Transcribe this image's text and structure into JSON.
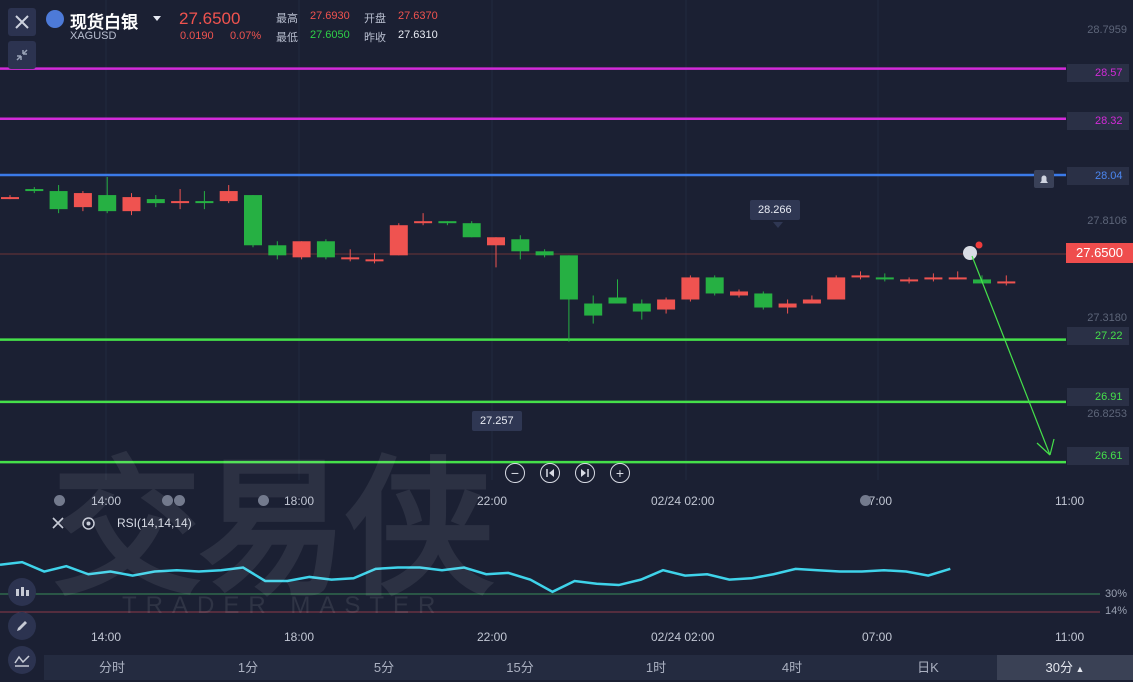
{
  "symbol": {
    "name": "现货白银",
    "code": "XAGUSD"
  },
  "quote": {
    "last": "27.6500",
    "change": "0.0190",
    "change_pct": "0.07%",
    "high_label": "最高",
    "high": "27.6930",
    "open_label": "开盘",
    "open": "27.6370",
    "low_label": "最低",
    "low": "27.6050",
    "prev_label": "昨收",
    "prev": "27.6310"
  },
  "axis": {
    "labels": [
      "28.7959",
      "27.8106",
      "27.3180",
      "26.8253"
    ]
  },
  "levels": [
    {
      "value": "28.57",
      "color": "#d22ad8"
    },
    {
      "value": "28.32",
      "color": "#d22ad8"
    },
    {
      "value": "28.04",
      "color": "#3b7ae8"
    },
    {
      "value": "27.22",
      "color": "#45e04a"
    },
    {
      "value": "26.91",
      "color": "#45e04a"
    },
    {
      "value": "26.61",
      "color": "#45e04a"
    }
  ],
  "current_price": "27.6500",
  "tooltips": {
    "high_marker": "28.266",
    "low_marker": "27.257"
  },
  "time_axis": [
    "14:00",
    "18:00",
    "22:00",
    "02/24 02:00",
    "07:00",
    "11:00"
  ],
  "indicator": {
    "title": "RSI(14,14,14)",
    "levels": [
      "30%",
      "14%"
    ]
  },
  "timeframes": [
    "分时",
    "1分",
    "5分",
    "15分",
    "1时",
    "4时",
    "日K"
  ],
  "timeframe_selected": "30分",
  "watermark": {
    "text": "交易侠",
    "sub": "TRADER MASTER"
  },
  "colors": {
    "up": "#ef5350",
    "down": "#26b043",
    "rsi": "#3fd3ea"
  },
  "chart_data": {
    "type": "candlestick",
    "unit": "price",
    "candles": [
      {
        "o": 27.93,
        "h": 27.94,
        "l": 27.92,
        "c": 27.93
      },
      {
        "o": 27.97,
        "h": 27.98,
        "l": 27.95,
        "c": 27.96
      },
      {
        "o": 27.96,
        "h": 27.99,
        "l": 27.85,
        "c": 27.87
      },
      {
        "o": 27.88,
        "h": 27.96,
        "l": 27.86,
        "c": 27.95
      },
      {
        "o": 27.94,
        "h": 28.03,
        "l": 27.85,
        "c": 27.86
      },
      {
        "o": 27.86,
        "h": 27.95,
        "l": 27.84,
        "c": 27.93
      },
      {
        "o": 27.92,
        "h": 27.94,
        "l": 27.88,
        "c": 27.9
      },
      {
        "o": 27.9,
        "h": 27.97,
        "l": 27.87,
        "c": 27.91
      },
      {
        "o": 27.91,
        "h": 27.96,
        "l": 27.87,
        "c": 27.9
      },
      {
        "o": 27.91,
        "h": 27.99,
        "l": 27.9,
        "c": 27.96
      },
      {
        "o": 27.94,
        "h": 27.94,
        "l": 27.68,
        "c": 27.69
      },
      {
        "o": 27.69,
        "h": 27.71,
        "l": 27.62,
        "c": 27.64
      },
      {
        "o": 27.63,
        "h": 27.71,
        "l": 27.62,
        "c": 27.71
      },
      {
        "o": 27.71,
        "h": 27.72,
        "l": 27.62,
        "c": 27.63
      },
      {
        "o": 27.62,
        "h": 27.67,
        "l": 27.61,
        "c": 27.63
      },
      {
        "o": 27.62,
        "h": 27.65,
        "l": 27.6,
        "c": 27.62
      },
      {
        "o": 27.64,
        "h": 27.8,
        "l": 27.64,
        "c": 27.79
      },
      {
        "o": 27.8,
        "h": 27.85,
        "l": 27.79,
        "c": 27.81
      },
      {
        "o": 27.81,
        "h": 27.81,
        "l": 27.79,
        "c": 27.8
      },
      {
        "o": 27.8,
        "h": 27.81,
        "l": 27.73,
        "c": 27.73
      },
      {
        "o": 27.69,
        "h": 27.73,
        "l": 27.58,
        "c": 27.73
      },
      {
        "o": 27.72,
        "h": 27.74,
        "l": 27.62,
        "c": 27.66
      },
      {
        "o": 27.66,
        "h": 27.67,
        "l": 27.63,
        "c": 27.64
      },
      {
        "o": 27.64,
        "h": 27.64,
        "l": 27.21,
        "c": 27.42
      },
      {
        "o": 27.4,
        "h": 27.44,
        "l": 27.3,
        "c": 27.34
      },
      {
        "o": 27.43,
        "h": 27.52,
        "l": 27.41,
        "c": 27.4
      },
      {
        "o": 27.4,
        "h": 27.42,
        "l": 27.32,
        "c": 27.36
      },
      {
        "o": 27.37,
        "h": 27.43,
        "l": 27.35,
        "c": 27.42
      },
      {
        "o": 27.42,
        "h": 27.54,
        "l": 27.41,
        "c": 27.53
      },
      {
        "o": 27.53,
        "h": 27.54,
        "l": 27.44,
        "c": 27.45
      },
      {
        "o": 27.44,
        "h": 27.47,
        "l": 27.43,
        "c": 27.46
      },
      {
        "o": 27.45,
        "h": 27.46,
        "l": 27.37,
        "c": 27.38
      },
      {
        "o": 27.38,
        "h": 27.42,
        "l": 27.35,
        "c": 27.4
      },
      {
        "o": 27.4,
        "h": 27.44,
        "l": 27.4,
        "c": 27.42
      },
      {
        "o": 27.42,
        "h": 27.54,
        "l": 27.42,
        "c": 27.53
      },
      {
        "o": 27.53,
        "h": 27.56,
        "l": 27.52,
        "c": 27.54
      },
      {
        "o": 27.53,
        "h": 27.55,
        "l": 27.51,
        "c": 27.52
      },
      {
        "o": 27.52,
        "h": 27.53,
        "l": 27.5,
        "c": 27.52
      },
      {
        "o": 27.52,
        "h": 27.55,
        "l": 27.51,
        "c": 27.53
      },
      {
        "o": 27.53,
        "h": 27.56,
        "l": 27.52,
        "c": 27.53
      },
      {
        "o": 27.52,
        "h": 27.54,
        "l": 27.5,
        "c": 27.5
      },
      {
        "o": 27.5,
        "h": 27.54,
        "l": 27.49,
        "c": 27.51
      }
    ],
    "rsi": [
      52,
      54,
      47,
      51,
      45,
      47,
      44,
      47,
      48,
      47,
      48,
      50,
      40,
      40,
      43,
      41,
      42,
      49,
      50,
      50,
      48,
      50,
      45,
      46,
      41,
      32,
      40,
      38,
      37,
      41,
      48,
      44,
      45,
      41,
      42,
      45,
      49,
      48,
      47,
      47,
      48,
      47,
      44,
      49
    ]
  }
}
